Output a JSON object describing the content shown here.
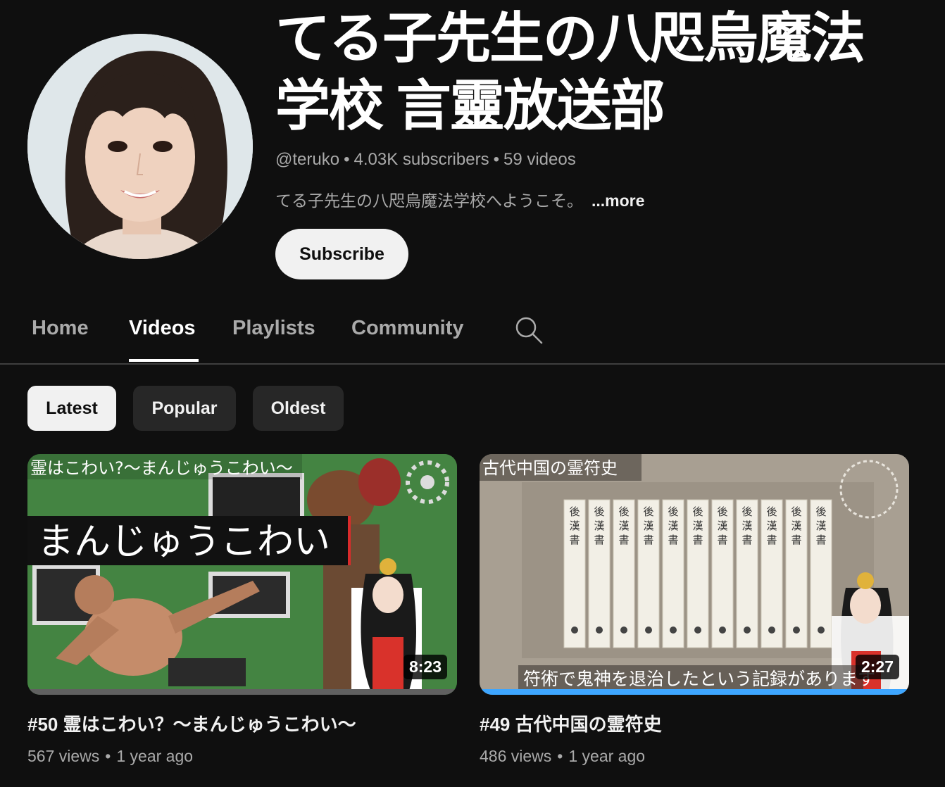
{
  "channel": {
    "title": "てる子先生の八咫烏魔法学校 言靈放送部",
    "handle": "@teruko",
    "subscribers": "4.03K subscribers",
    "video_count": "59 videos",
    "description": "てる子先生の八咫烏魔法学校へようこそ。",
    "more_label": "...more",
    "subscribe_label": "Subscribe"
  },
  "tabs": [
    {
      "label": "Home"
    },
    {
      "label": "Videos"
    },
    {
      "label": "Playlists"
    },
    {
      "label": "Community"
    }
  ],
  "active_tab": "Videos",
  "chips": [
    {
      "label": "Latest"
    },
    {
      "label": "Popular"
    },
    {
      "label": "Oldest"
    }
  ],
  "active_chip": "Latest",
  "videos": [
    {
      "title": "#50 霊はこわい？〜まんじゅうこわい〜",
      "views": "567 views",
      "age": "1 year ago",
      "duration": "8:23",
      "thumb_caption_top": "霊はこわい?〜まんじゅうこわい〜",
      "thumb_caption_main": "まんじゅうこわい",
      "watched_fraction": 0
    },
    {
      "title": "#49 古代中国の霊符史",
      "views": "486 views",
      "age": "1 year ago",
      "duration": "2:27",
      "thumb_caption_top": "古代中国の霊符史",
      "thumb_caption_bottom": "符術で鬼神を退治したという記録があります",
      "book_label": "後漢書",
      "watched_fraction": 1.0
    }
  ],
  "colors": {
    "background": "#0f0f0f",
    "progress": "#3ea6ff",
    "chip_active": "#f1f1f1",
    "chip_inactive": "#272727"
  }
}
